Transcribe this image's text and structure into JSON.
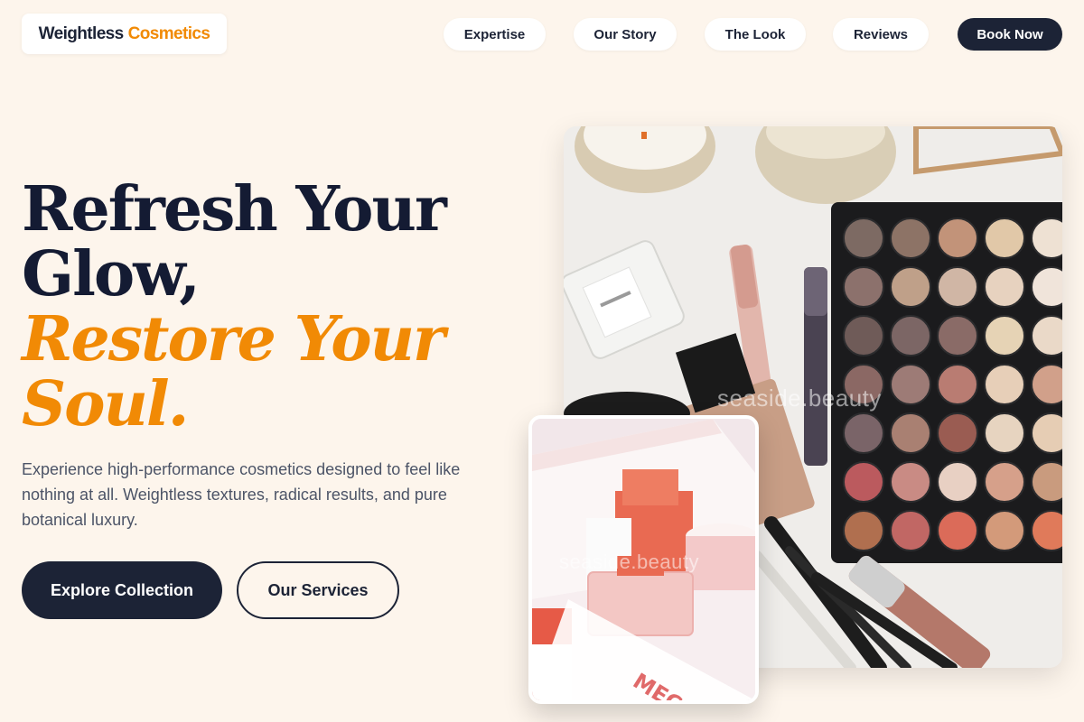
{
  "header": {
    "brand_primary": "Weightless",
    "brand_accent": "Cosmetics",
    "nav": {
      "expertise": "Expertise",
      "story": "Our Story",
      "look": "The Look",
      "reviews": "Reviews",
      "book": "Book Now"
    }
  },
  "hero": {
    "headline_line1": "Refresh Your",
    "headline_line2": "Glow,",
    "headline_accent_line1": "Restore Your",
    "headline_accent_line2": "Soul.",
    "lead": "Experience high-performance cosmetics designed to feel like nothing at all. Weightless textures, radical results, and pure botanical luxury.",
    "cta_primary": "Explore Collection",
    "cta_secondary": "Our Services"
  },
  "images": {
    "main_watermark": "seaside.beauty",
    "secondary_watermark": "seaside.beauty"
  },
  "colors": {
    "background": "#fdf5ec",
    "navy": "#1c2336",
    "accent": "#f18a05"
  }
}
